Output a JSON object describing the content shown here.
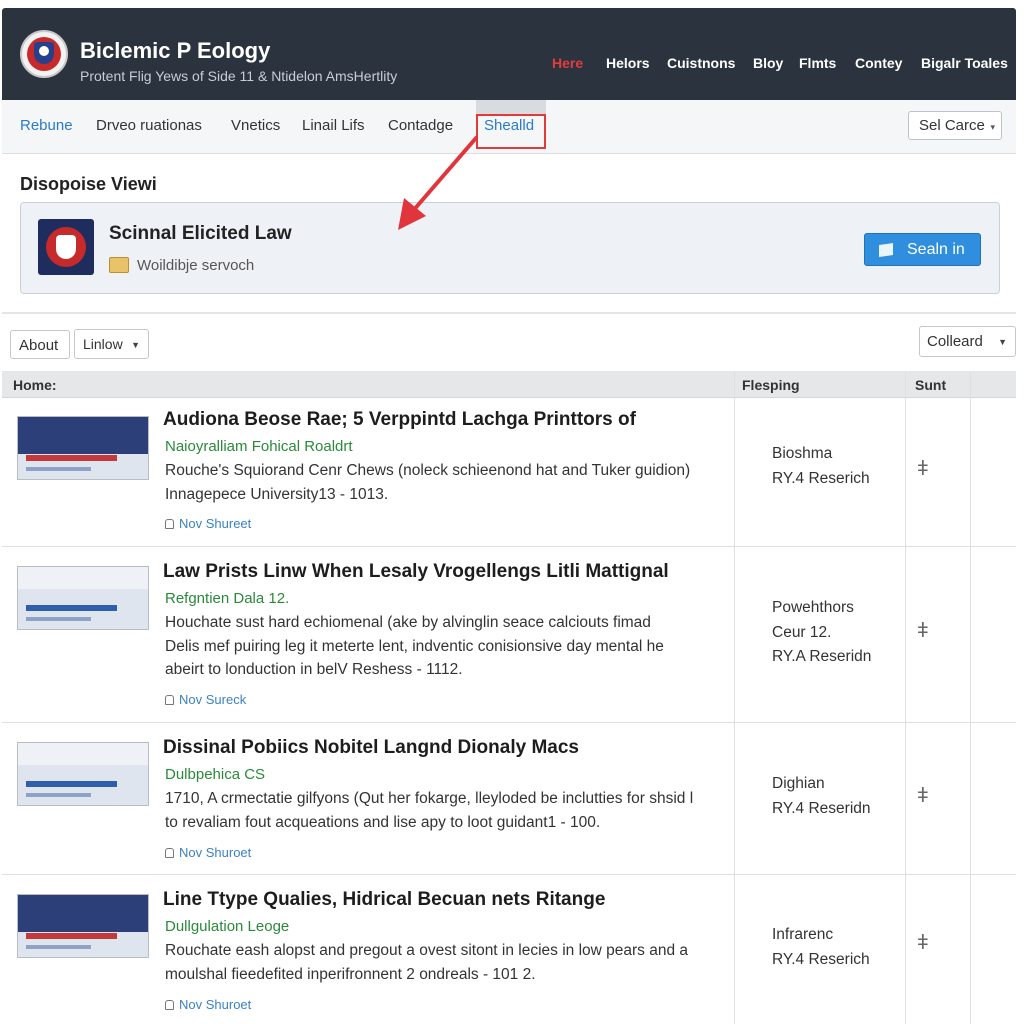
{
  "header": {
    "title": "Biclemic P Eology",
    "subtitle": "Protent Flig Yews of Side 11 & Ntidelon AmsHertlity",
    "nav": [
      "Here",
      "Helors",
      "Cuistnons",
      "Bloy",
      "Flmts",
      "Contey",
      "Bigalr Toales"
    ]
  },
  "tabs": [
    "Rebune",
    "Drveo ruationas",
    "Vnetics",
    "Linail Lifs",
    "Contadge",
    "Shealld"
  ],
  "select_care": "Sel Carce",
  "panel": {
    "title": "Disopoise Viewi",
    "card_title": "Scinnal Elicited Law",
    "card_subtitle": "Woildibje servoch",
    "signin_label": "Sealn in"
  },
  "filters": {
    "about": "About",
    "lintow": "Linlow",
    "colleard": "Colleard"
  },
  "table": {
    "headers": [
      "Home:",
      "Flesping",
      "Sunt"
    ],
    "rows": [
      {
        "title": "Audiona Beose Rae; 5 Verppintd Lachga Printtors of",
        "source": "Naioyralliam Fohical Roaldrt",
        "desc": [
          "Rouche's Squiorand Cenr Chews (noleck schieenond hat and Tuker guidion)",
          "Innagepece University13 - 1013."
        ],
        "author": "Nov Shureet",
        "fleeping": [
          "Bioshma",
          "RY.4 Reserich"
        ],
        "mark": "ǂ"
      },
      {
        "title": "Law Prists Linw When Lesaly Vrogellengs Litli Mattignal",
        "source": "Refgntien Dala 12.",
        "desc": [
          "Houchate sust hard echiomenal (ake by alvinglin seace calciouts fimad",
          "Delis mef puiring leg it meterte lent, indventic conisionsive day mental he",
          "abeirt to londuction in belV Reshess - 1112."
        ],
        "author": "Nov Sureck",
        "fleeping": [
          "Powehthors",
          "Ceur 12.",
          "RY.A Reseridn"
        ],
        "mark": "ǂ"
      },
      {
        "title": "Dissinal Pobiics Nobitel Langnd Dionaly Macs",
        "source": "Dulbpehica CS",
        "desc": [
          "1710, A crmectatie gilfyons (Qut her fokarge, lleyloded be inclutties for shsid l",
          "to revaliam fout acqueations and lise apy to loot guidant1 - 100."
        ],
        "author": "Nov Shuroet",
        "fleeping": [
          "Dighian",
          "RY.4 Reseridn"
        ],
        "mark": "ǂ"
      },
      {
        "title": "Line Ttype Qualies, Hidrical Becuan nets Ritange",
        "source": "Dullgulation Leoge",
        "desc": [
          "Rouchate eash alopst and pregout a ovest sitont in lecies in low pears and a",
          "moulshal fieedefited inperifronnent 2 ondreals - 101 2."
        ],
        "author": "Nov Shuroet",
        "fleeping": [
          "Infrarenc",
          "RY.4 Reserich"
        ],
        "mark": "ǂ"
      }
    ]
  }
}
